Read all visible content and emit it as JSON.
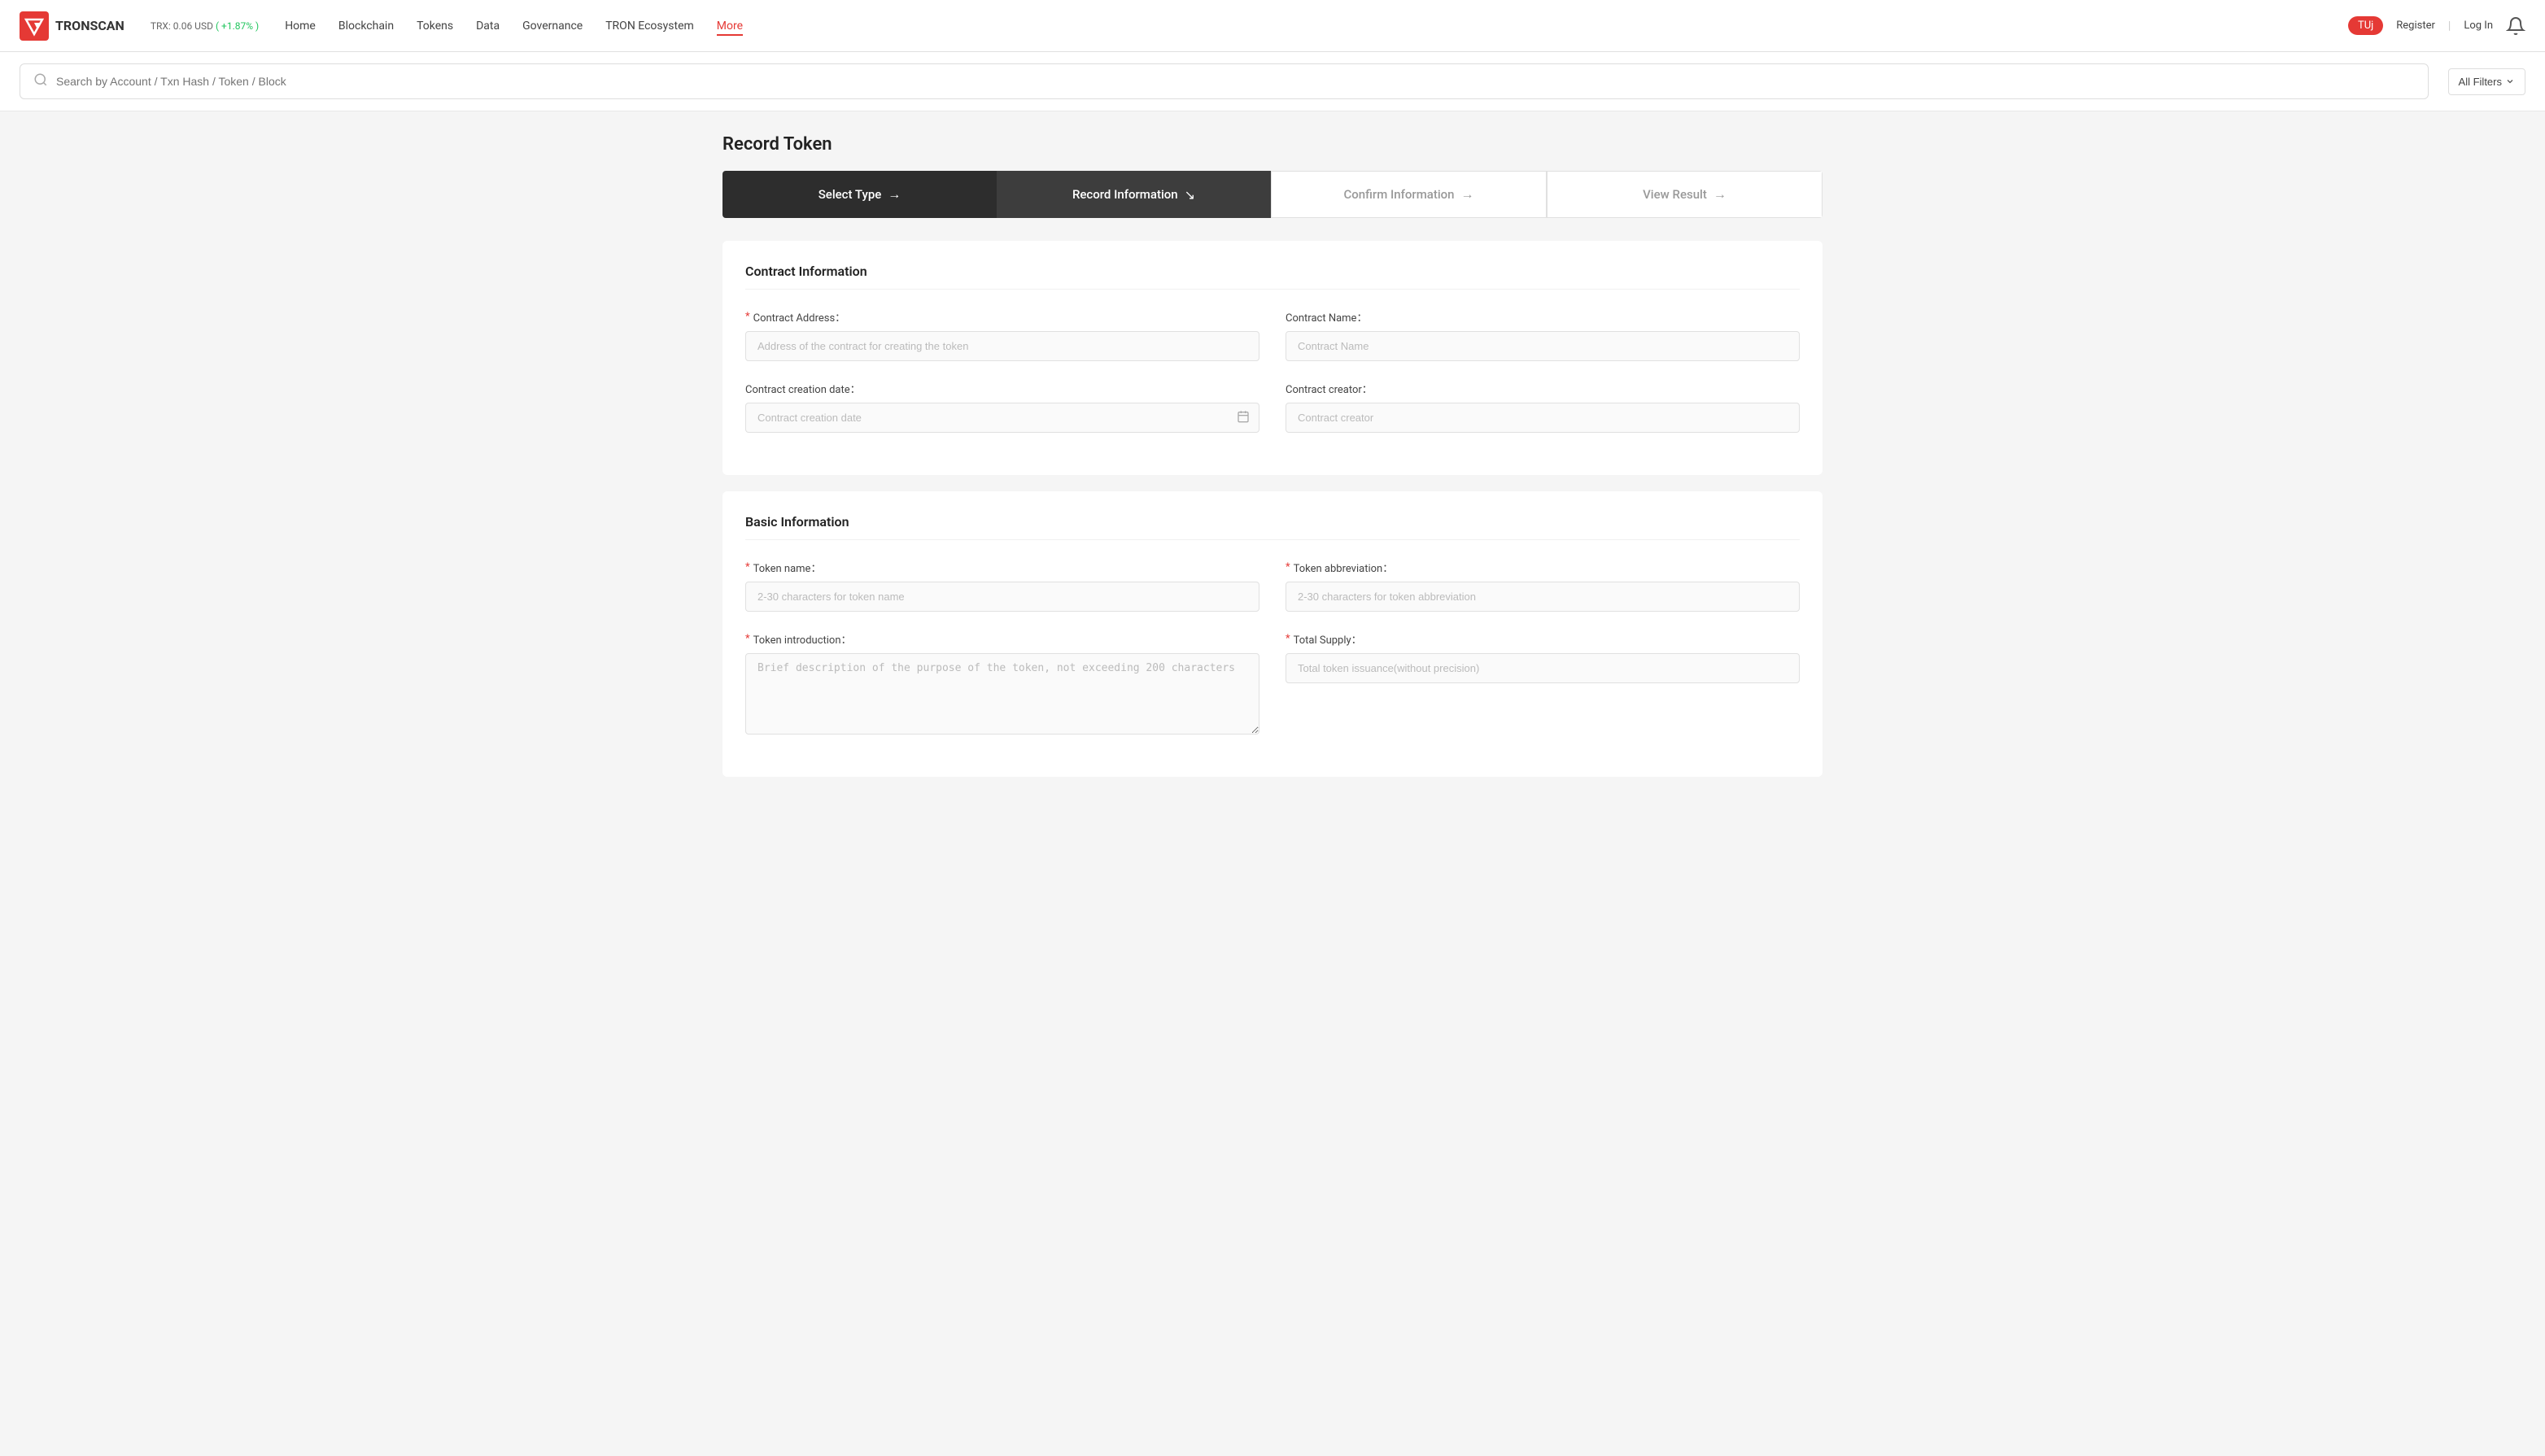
{
  "header": {
    "logo_text": "TRONSCAN",
    "trx_price": "TRX: 0.06 USD",
    "trx_change": "( +1.87% )",
    "nav": [
      {
        "label": "Home",
        "active": false
      },
      {
        "label": "Blockchain",
        "active": false
      },
      {
        "label": "Tokens",
        "active": false
      },
      {
        "label": "Data",
        "active": false
      },
      {
        "label": "Governance",
        "active": false
      },
      {
        "label": "TRON Ecosystem",
        "active": false
      },
      {
        "label": "More",
        "active": true
      }
    ],
    "user_label": "TUj",
    "register_label": "Register",
    "login_label": "Log In"
  },
  "search": {
    "placeholder": "Search by Account / Txn Hash / Token / Block",
    "filters_label": "All Filters"
  },
  "page": {
    "title": "Record Token"
  },
  "stepper": {
    "steps": [
      {
        "label": "Select Type",
        "arrow": "→",
        "state": "done"
      },
      {
        "label": "Record Information",
        "arrow": "↘",
        "state": "active"
      },
      {
        "label": "Confirm Information",
        "arrow": "→",
        "state": "inactive"
      },
      {
        "label": "View Result",
        "arrow": "→",
        "state": "inactive"
      }
    ]
  },
  "contract_section": {
    "title": "Contract Information",
    "contract_address": {
      "label": "Contract Address：",
      "required": true,
      "placeholder": "Address of the contract for creating the token"
    },
    "contract_name": {
      "label": "Contract Name：",
      "required": false,
      "placeholder": "Contract Name"
    },
    "contract_creation_date": {
      "label": "Contract creation date：",
      "required": false,
      "placeholder": "Contract creation date"
    },
    "contract_creator": {
      "label": "Contract creator：",
      "required": false,
      "placeholder": "Contract creator"
    }
  },
  "basic_section": {
    "title": "Basic Information",
    "token_name": {
      "label": "Token name：",
      "required": true,
      "placeholder": "2-30 characters for token name"
    },
    "token_abbreviation": {
      "label": "Token abbreviation：",
      "required": true,
      "placeholder": "2-30 characters for token abbreviation"
    },
    "token_introduction": {
      "label": "Token introduction：",
      "required": true,
      "placeholder": "Brief description of the purpose of the token, not exceeding 200 characters"
    },
    "total_supply": {
      "label": "Total Supply：",
      "required": true,
      "placeholder": "Total token issuance(without precision)"
    }
  }
}
